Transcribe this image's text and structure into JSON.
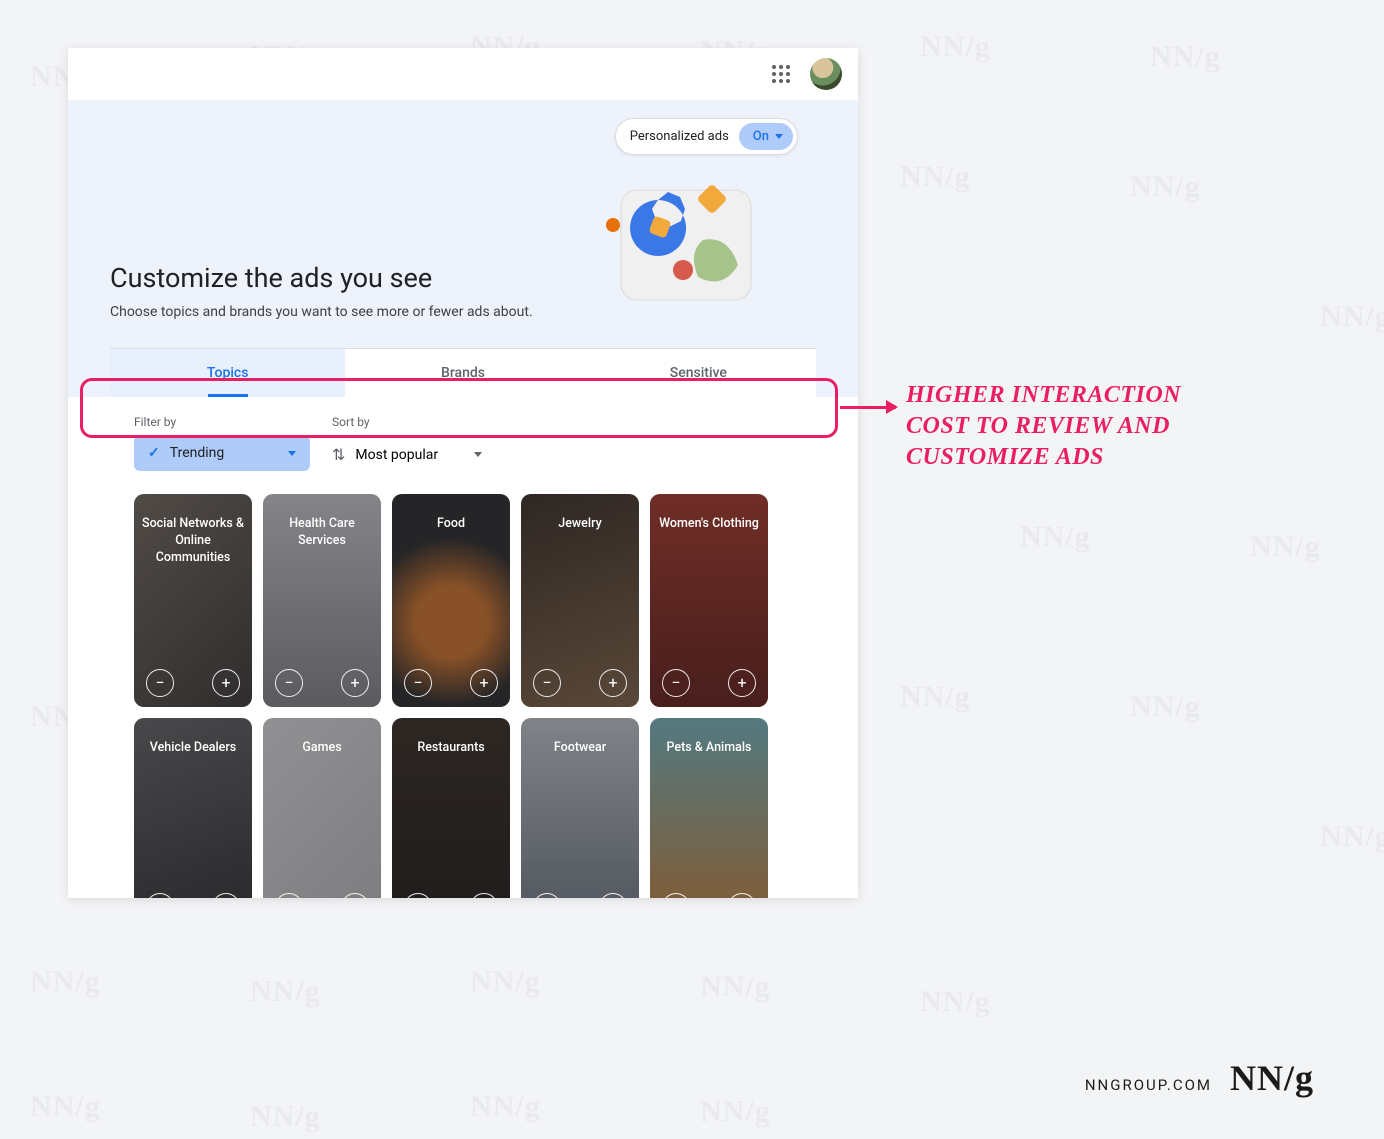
{
  "header": {
    "apps_icon": "apps-grid",
    "avatar": "user-avatar"
  },
  "toggle": {
    "label": "Personalized ads",
    "state": "On"
  },
  "hero": {
    "title": "Customize the ads you see",
    "subtitle": "Choose topics and brands you want to see more or fewer ads about."
  },
  "tabs": [
    {
      "label": "Topics",
      "active": true
    },
    {
      "label": "Brands",
      "active": false
    },
    {
      "label": "Sensitive",
      "active": false
    }
  ],
  "filters": {
    "filter_by_label": "Filter by",
    "filter_by_value": "Trending",
    "sort_by_label": "Sort by",
    "sort_by_value": "Most popular"
  },
  "cards": [
    {
      "label": "Social Networks & Online Communities",
      "bg": "linear-gradient(135deg,#7a6f63,#3d3a36)"
    },
    {
      "label": "Health Care Services",
      "bg": "linear-gradient(180deg,#d8d8dc,#8c8c92)"
    },
    {
      "label": "Food",
      "bg": "radial-gradient(circle at 50% 60%, #e07b2a 0 25%, #2a2a2a 60%)"
    },
    {
      "label": "Jewelry",
      "bg": "linear-gradient(160deg,#3b2e24,#8a6a4a)"
    },
    {
      "label": "Women's Clothing",
      "bg": "linear-gradient(180deg,#b33a2a,#6a1f18)"
    },
    {
      "label": "Vehicle Dealers",
      "bg": "linear-gradient(160deg,#6b6b6b,#2f2f2f)"
    },
    {
      "label": "Games",
      "bg": "linear-gradient(135deg,#efefef,#c9c9c9)"
    },
    {
      "label": "Restaurants",
      "bg": "linear-gradient(180deg,#3a2e24,#1e1a16)"
    },
    {
      "label": "Footwear",
      "bg": "linear-gradient(180deg,#d0d4db,#76808c)"
    },
    {
      "label": "Pets & Animals",
      "bg": "linear-gradient(180deg,#7fc4cc,#d88a3a)"
    }
  ],
  "annotation": {
    "text": "HIGHER INTERACTION COST TO REVIEW AND CUSTOMIZE ADS"
  },
  "footer": {
    "url": "NNGROUP.COM",
    "logo": "NN/g"
  },
  "watermark": "NN/g"
}
